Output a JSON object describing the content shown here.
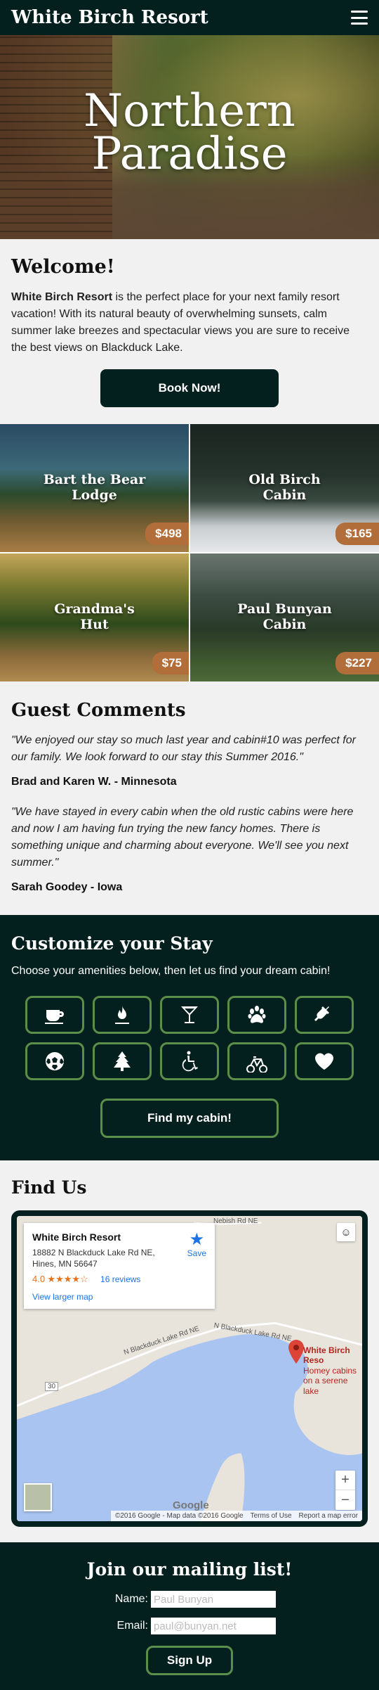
{
  "header": {
    "brand": "White Birch Resort",
    "menu_icon": "hamburger-menu-icon"
  },
  "hero": {
    "title_line1": "Northern",
    "title_line2": "Paradise"
  },
  "welcome": {
    "heading": "Welcome!",
    "resort_name": "White Birch Resort",
    "text": " is the perfect place for your next family resort vacation! With its natural beauty of overwhelming sunsets, calm summer lake breezes and spectacular views you are sure to receive the best views on Blackduck Lake.",
    "book_label": "Book Now!"
  },
  "cabins": [
    {
      "name_line1": "Bart the Bear",
      "name_line2": "Lodge",
      "price": "$498"
    },
    {
      "name_line1": "Old Birch",
      "name_line2": "Cabin",
      "price": "$165"
    },
    {
      "name_line1": "Grandma's",
      "name_line2": "Hut",
      "price": "$75"
    },
    {
      "name_line1": "Paul Bunyan",
      "name_line2": "Cabin",
      "price": "$227"
    }
  ],
  "comments": {
    "heading": "Guest Comments",
    "items": [
      {
        "quote": "\"We enjoyed our stay so much last year and cabin#10 was perfect for our family. We look forward to our stay this Summer 2016.\"",
        "author": "Brad and Karen W. - Minnesota"
      },
      {
        "quote": "\"We have stayed in every cabin when the old rustic cabins were here and now I am having fun trying the new fancy homes. There is something unique and charming about everyone. We'll see you next summer.\"",
        "author": "Sarah Goodey - Iowa"
      }
    ]
  },
  "customize": {
    "heading": "Customize your Stay",
    "text": "Choose your amenities below, then let us find your dream cabin!",
    "amenities": [
      "coffee-icon",
      "fire-icon",
      "cocktail-icon",
      "paw-icon",
      "plug-icon",
      "soccer-ball-icon",
      "tree-icon",
      "wheelchair-icon",
      "bicycle-icon",
      "heart-icon"
    ],
    "find_label": "Find my cabin!"
  },
  "findus": {
    "heading": "Find Us",
    "map": {
      "place": "White Birch Resort",
      "address1": "18882 N Blackduck Lake Rd NE,",
      "address2": "Hines, MN 56647",
      "rating": "4.0",
      "stars": "★★★★☆",
      "reviews": "16 reviews",
      "larger_map": "View larger map",
      "save": "Save",
      "pin_title": "White Birch Reso",
      "pin_line1": "Homey cabins",
      "pin_line2": "on a serene lake",
      "road1": "Nebish Rd NE",
      "road2": "N Blackduck Lake Rd NE",
      "road3": "N Blackduck Lake Rd NE",
      "road_num": "30",
      "zoom_in": "+",
      "zoom_out": "−",
      "google": "Google",
      "attr1": "©2016 Google - Map data ©2016 Google",
      "attr2": "Terms of Use",
      "attr3": "Report a map error"
    }
  },
  "mailing": {
    "heading": "Join our mailing list!",
    "name_label": "Name:",
    "name_placeholder": "Paul Bunyan",
    "email_label": "Email:",
    "email_placeholder": "paul@bunyan.net",
    "signup_label": "Sign Up"
  },
  "colors": {
    "dark": "#04201e",
    "accent_green": "#5b8e4a",
    "price_tag": "#b26e3a"
  }
}
